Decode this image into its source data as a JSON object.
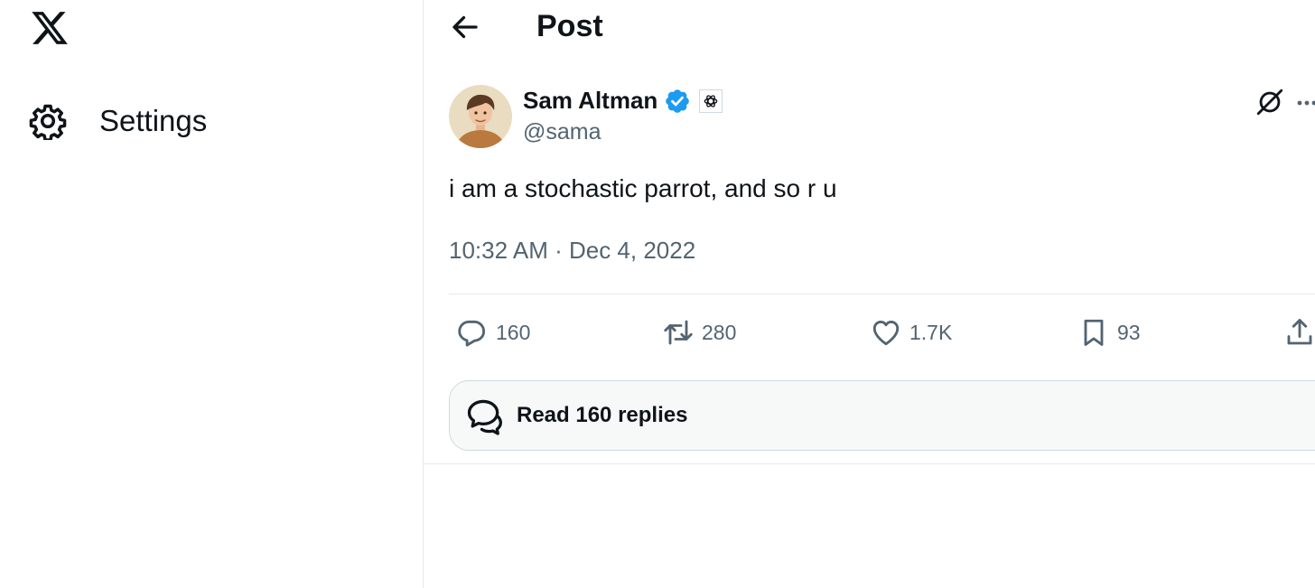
{
  "sidebar": {
    "logo_icon": "x-logo-icon",
    "items": [
      {
        "label": "Settings",
        "icon": "gear-icon"
      }
    ]
  },
  "header": {
    "back_icon": "arrow-left-icon",
    "title": "Post"
  },
  "post": {
    "author": {
      "name": "Sam Altman",
      "handle": "@sama",
      "avatar": "avatar-illustrated-man",
      "verified_icon": "verified-badge-icon",
      "affiliation_icon": "openai-logo-icon"
    },
    "text": "i am a stochastic parrot, and so r u",
    "time": "10:32 AM",
    "separator": " · ",
    "date": "Dec 4, 2022",
    "actions": {
      "replies": "160",
      "reposts": "280",
      "likes": "1.7K",
      "bookmarks": "93"
    },
    "read_replies_label": "Read 160 replies"
  },
  "colors": {
    "text_primary": "#0f1419",
    "text_secondary": "#536471",
    "verified_blue": "#1d9bf0",
    "border": "#e7e9ea",
    "button_bg": "#f7f9f9"
  }
}
